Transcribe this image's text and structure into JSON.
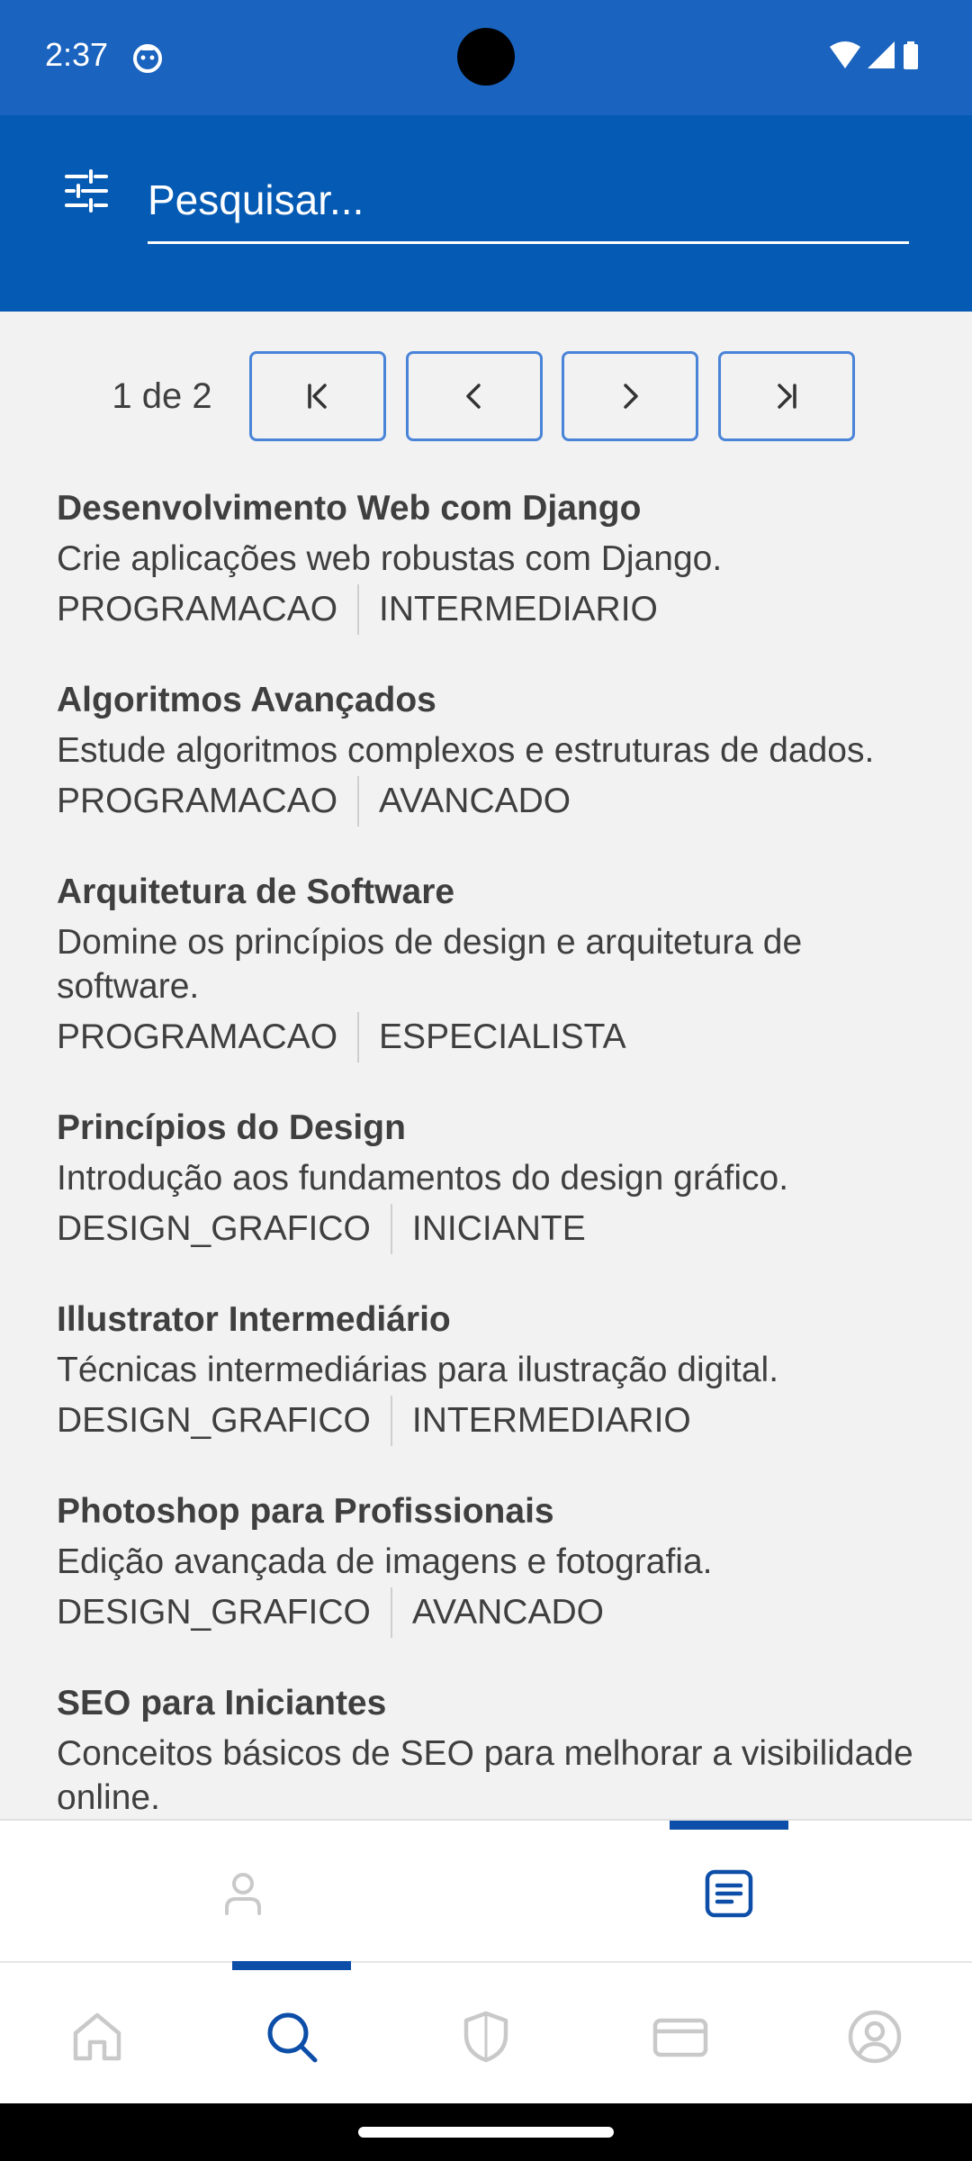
{
  "status_bar": {
    "time": "2:37",
    "icons": [
      "app-notification-icon",
      "wifi-icon",
      "cellular-signal-icon",
      "battery-icon"
    ]
  },
  "search": {
    "placeholder": "Pesquisar...",
    "value": ""
  },
  "pagination": {
    "indicator": "1 de 2",
    "buttons": [
      "first-page-icon",
      "previous-page-icon",
      "next-page-icon",
      "last-page-icon"
    ]
  },
  "courses": [
    {
      "title": "Desenvolvimento Web com Django",
      "description": "Crie aplicações web robustas com Django.",
      "category": "PROGRAMACAO",
      "level": "INTERMEDIARIO"
    },
    {
      "title": "Algoritmos Avançados",
      "description": "Estude algoritmos complexos e estruturas de dados.",
      "category": "PROGRAMACAO",
      "level": "AVANCADO"
    },
    {
      "title": "Arquitetura de Software",
      "description": "Domine os princípios de design e arquitetura de software.",
      "category": "PROGRAMACAO",
      "level": "ESPECIALISTA"
    },
    {
      "title": "Princípios do Design",
      "description": "Introdução aos fundamentos do design gráfico.",
      "category": "DESIGN_GRAFICO",
      "level": "INICIANTE"
    },
    {
      "title": "Illustrator Intermediário",
      "description": "Técnicas intermediárias para ilustração digital.",
      "category": "DESIGN_GRAFICO",
      "level": "INTERMEDIARIO"
    },
    {
      "title": "Photoshop para Profissionais",
      "description": "Edição avançada de imagens e fotografia.",
      "category": "DESIGN_GRAFICO",
      "level": "AVANCADO"
    },
    {
      "title": "SEO para Iniciantes",
      "description": "Conceitos básicos de SEO para melhorar a visibilidade online.",
      "category": "",
      "level": ""
    }
  ],
  "sub_tabs": {
    "items": [
      "person-icon",
      "article-icon"
    ],
    "active": "article-icon"
  },
  "bottom_nav": {
    "items": [
      "home-icon",
      "search-icon",
      "shield-icon",
      "card-icon",
      "account-icon"
    ],
    "active": "search-icon"
  },
  "colors": {
    "status_bar": "#1a63be",
    "app_bar": "#055ab4",
    "accent": "#0c4ea8",
    "inactive_icon": "#c9c9c9",
    "background": "#f2f2f2"
  }
}
